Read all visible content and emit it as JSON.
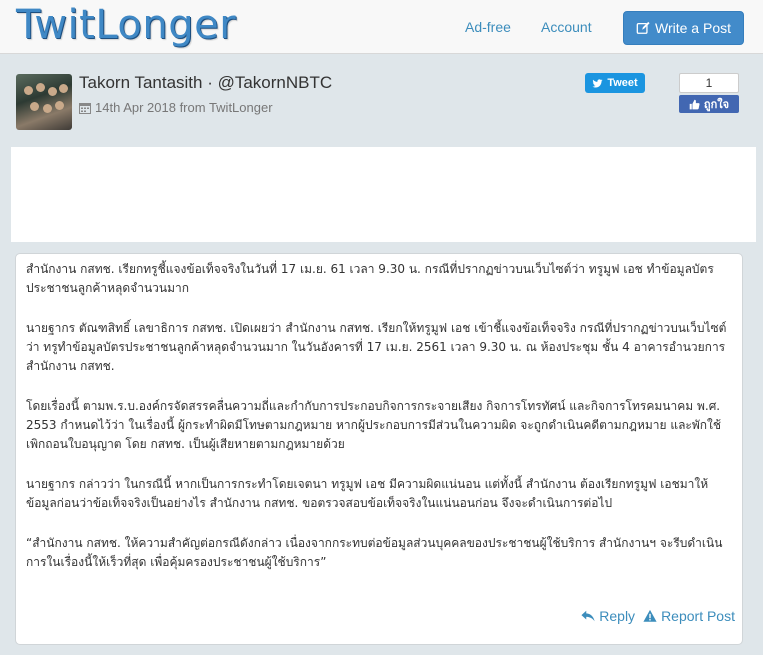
{
  "nav": {
    "logo": "TwitLonger",
    "adfree": "Ad-free",
    "account": "Account",
    "write_post": "Write a Post"
  },
  "post_header": {
    "author": "Takorn Tantasith · @TakornNBTC",
    "date": "14th Apr 2018 from TwitLonger",
    "tweet_label": "Tweet",
    "like_count": "1",
    "like_label": "ถูกใจ"
  },
  "post": {
    "paragraphs": [
      "สำนักงาน กสทช. เรียกทรูชี้แจงข้อเท็จจริงในวันที่ 17 เม.ย. 61 เวลา 9.30 น. กรณีที่ปรากฏข่าวบนเว็บไซต์ว่า ทรูมูฟ เอช ทำข้อมูลบัตรประชาชนลูกค้าหลุดจำนวนมาก",
      "นายฐากร ตัณฑสิทธิ์ เลขาธิการ กสทช. เปิดเผยว่า สำนักงาน กสทช. เรียกให้ทรูมูฟ เอช เข้าชี้แจงข้อเท็จจริง กรณีที่ปรากฏข่าวบนเว็บไซต์ว่า ทรูทำข้อมูลบัตรประชาชนลูกค้าหลุดจำนวนมาก ในวันอังคารที่ 17 เม.ย. 2561 เวลา 9.30 น. ณ ห้องประชุม ชั้น 4 อาคารอำนวยการ สำนักงาน กสทช.",
      "โดยเรื่องนี้ ตามพ.ร.บ.องค์กรจัดสรรคลื่นความถี่และกำกับการประกอบกิจการกระจายเสียง กิจการโทรทัศน์ และกิจการโทรคมนาคม พ.ศ. 2553 กำหนดไว้ว่า ในเรื่องนี้ ผู้กระทำผิดมีโทษตามกฎหมาย หากผู้ประกอบการมีส่วนในความผิด จะถูกดำเนินคดีตามกฎหมาย และพักใช้ เพิกถอนใบอนุญาต โดย กสทช. เป็นผู้เสียหายตามกฎหมายด้วย",
      "นายฐากร กล่าวว่า ในกรณีนี้ หากเป็นการกระทำโดยเจตนา ทรูมูฟ เอช มีความผิดแน่นอน แต่ทั้งนี้ สำนักงาน ต้องเรียกทรูมูฟ เอชมาให้ข้อมูลก่อนว่าข้อเท็จจริงเป็นอย่างไร สำนักงาน กสทช. ขอตรวจสอบข้อเท็จจริงในแน่นอนก่อน จึงจะดำเนินการต่อไป",
      "“สำนักงาน กสทช. ให้ความสำคัญต่อกรณีดังกล่าว เนื่องจากกระทบต่อข้อมูลส่วนบุคคลของประชาชนผู้ใช้บริการ สำนักงานฯ จะรีบดำเนินการในเรื่องนี้ให้เร็วที่สุด เพื่อคุ้มครองประชาชนผู้ใช้บริการ”"
    ],
    "reply_label": "Reply",
    "report_label": "Report Post"
  },
  "colors": {
    "accent": "#428bca",
    "link": "#3c8dbc",
    "tweet": "#1b95e0",
    "facebook": "#4267b2",
    "page_bg": "#dfe6ea"
  },
  "icons": {
    "write": "pencil-square-icon",
    "date": "calendar-icon",
    "tweet": "twitter-bird-icon",
    "like": "thumbs-up-icon",
    "reply": "reply-arrow-icon",
    "report": "warning-icon"
  }
}
